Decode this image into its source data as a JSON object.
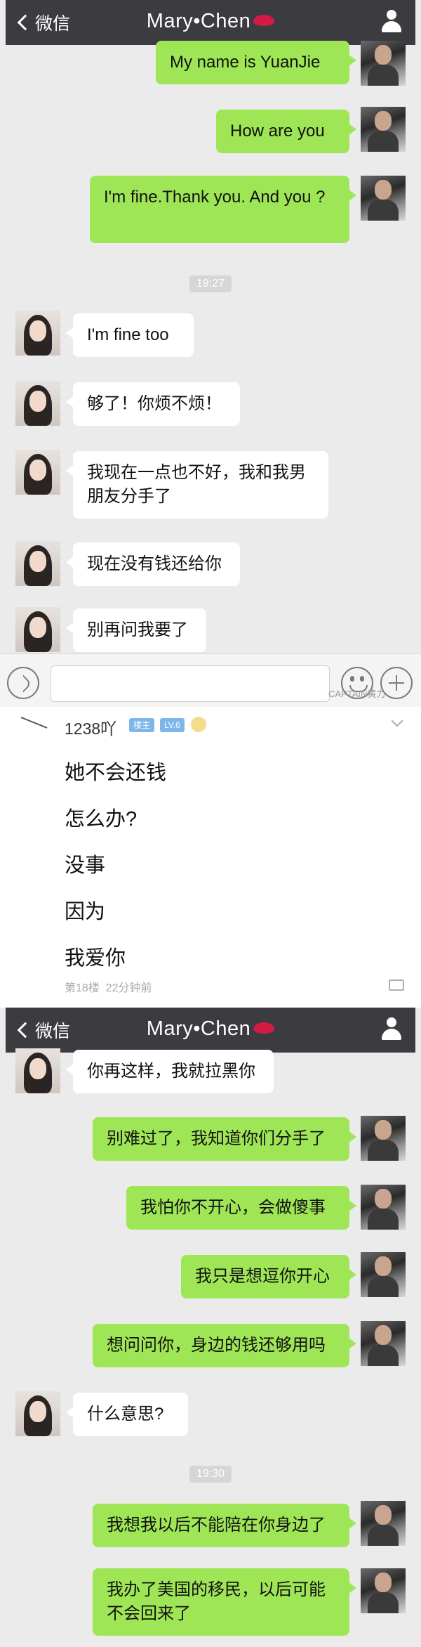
{
  "screen1": {
    "nav": {
      "back_label": "微信",
      "title": "Mary•Chen"
    },
    "messages": [
      {
        "from": "me",
        "text": "My name is YuanJie"
      },
      {
        "from": "me",
        "text": "How are you"
      },
      {
        "from": "me",
        "text": "I'm fine.Thank you. And you ?"
      },
      {
        "from": "her",
        "text": "I'm fine too"
      },
      {
        "from": "her",
        "text": "够了！你烦不烦！"
      },
      {
        "from": "her",
        "text": "我现在一点也不好，我和我男朋友分手了"
      },
      {
        "from": "her",
        "text": "现在没有钱还给你"
      },
      {
        "from": "her",
        "text": "别再问我要了"
      }
    ],
    "timestamp": "19:27",
    "watermark": "CAPTAIN黄力"
  },
  "post": {
    "username": "1238吖",
    "badge_host": "楼主",
    "badge_level": "LV.6",
    "lines": [
      "她不会还钱",
      "怎么办?",
      "没事",
      "因为",
      "我爱你"
    ],
    "floor": "第18楼",
    "time_ago": "22分钟前"
  },
  "screen2": {
    "nav": {
      "back_label": "微信",
      "title": "Mary•Chen"
    },
    "messages": [
      {
        "from": "her",
        "text": "你再这样，我就拉黑你"
      },
      {
        "from": "me",
        "text": "别难过了，我知道你们分手了"
      },
      {
        "from": "me",
        "text": "我怕你不开心，会做傻事"
      },
      {
        "from": "me",
        "text": "我只是想逗你开心"
      },
      {
        "from": "me",
        "text": "想问问你，身边的钱还够用吗"
      },
      {
        "from": "her",
        "text": "什么意思?"
      },
      {
        "from": "me",
        "text": "我想我以后不能陪在你身边了"
      },
      {
        "from": "me",
        "text": "我办了美国的移民，以后可能不会回来了"
      }
    ],
    "timestamp": "19:30"
  },
  "colors": {
    "nav_bg": "#3b3b40",
    "chat_bg": "#ebebeb",
    "bubble_me": "#9fe656",
    "bubble_her": "#ffffff",
    "lips": "#d31b46"
  },
  "icons": [
    "back-chevron-icon",
    "lips-emoji-icon",
    "contact-person-icon",
    "voice-icon",
    "emoji-icon",
    "plus-icon",
    "comment-icon"
  ]
}
